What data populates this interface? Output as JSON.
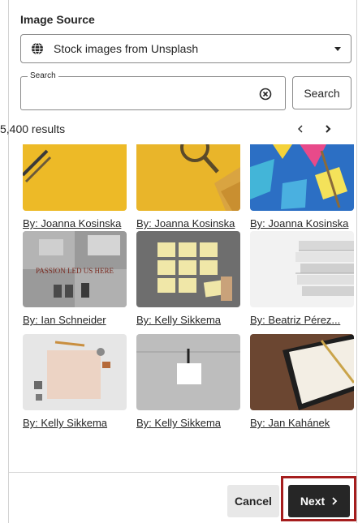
{
  "header": {
    "title": "Image Source"
  },
  "source": {
    "selected": "Stock images from Unsplash",
    "icon": "globe-icon"
  },
  "search": {
    "legend": "Search",
    "value": "",
    "placeholder": "",
    "button_label": "Search"
  },
  "results": {
    "count_label": "5,400 results"
  },
  "images": [
    {
      "credit": "By: Joanna Kosinska",
      "thumb": "pencils-on-yellow"
    },
    {
      "credit": "By: Joanna Kosinska",
      "thumb": "magnifier-on-yellow"
    },
    {
      "credit": "By: Joanna Kosinska",
      "thumb": "colored-paper-on-blue"
    },
    {
      "credit": "By: Ian Schneider",
      "thumb": "passion-led-us-here"
    },
    {
      "credit": "By: Kelly Sikkema",
      "thumb": "sticky-notes-grid"
    },
    {
      "credit": "By: Beatriz Pérez...",
      "thumb": "stacked-books"
    },
    {
      "credit": "By: Kelly Sikkema",
      "thumb": "blank-paper-desk"
    },
    {
      "credit": "By: Kelly Sikkema",
      "thumb": "hanging-note"
    },
    {
      "credit": "By: Jan Kahánek",
      "thumb": "notebook-and-pen"
    }
  ],
  "footer": {
    "cancel_label": "Cancel",
    "next_label": "Next"
  },
  "colors": {
    "highlight": "#a51d1d",
    "primary_button": "#262626"
  }
}
